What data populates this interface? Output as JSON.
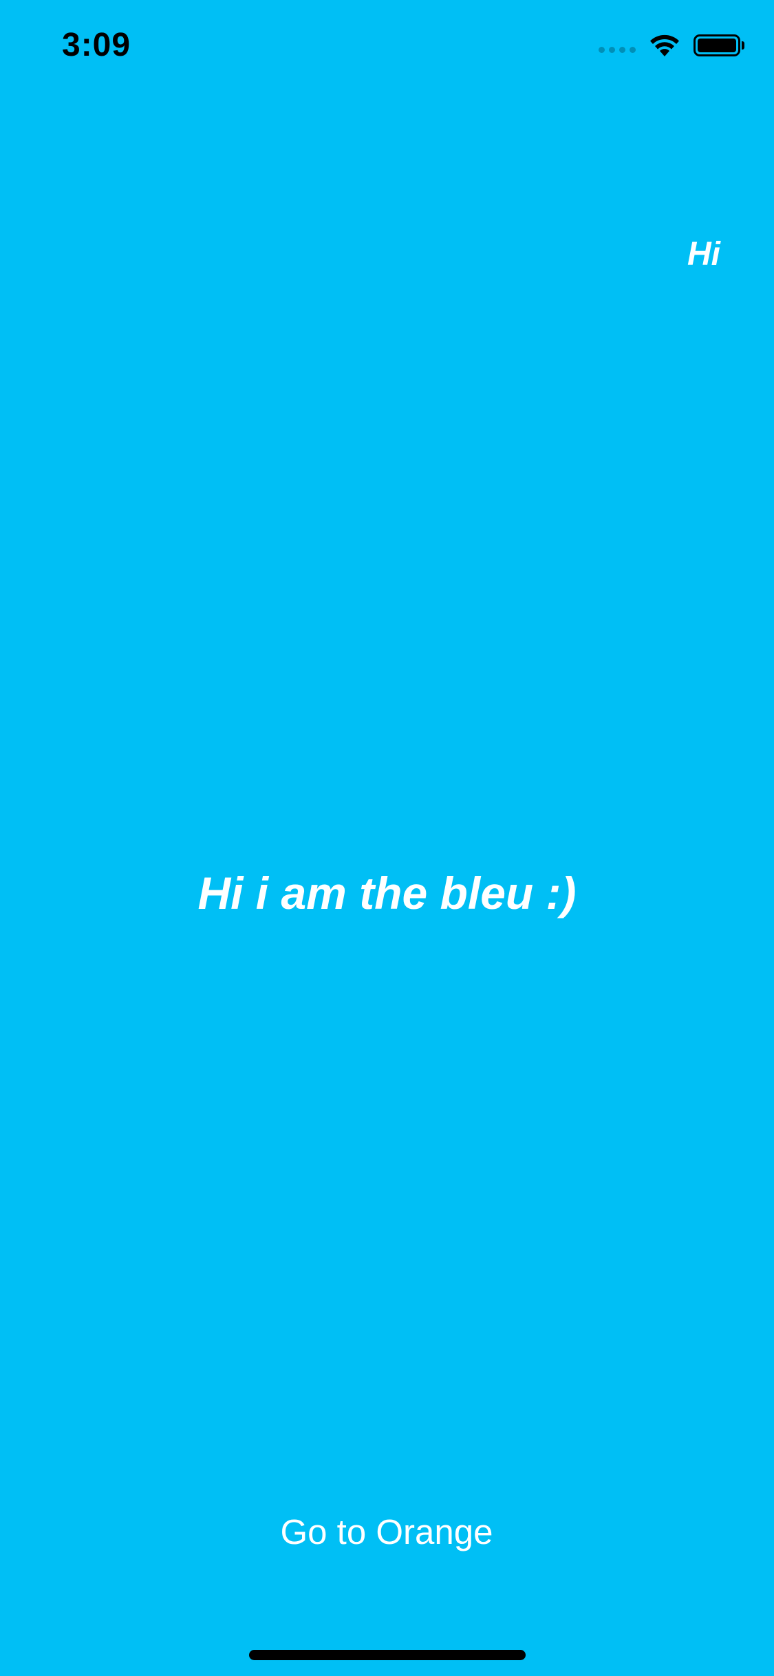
{
  "status_bar": {
    "time": "3:09",
    "icons": [
      "signal-dots-icon",
      "wifi-icon",
      "battery-icon"
    ],
    "battery_level": 1.0
  },
  "screen": {
    "background_color": "#00BFF5",
    "corner_label": "Hi",
    "main_label": "Hi i am the bleu :)",
    "button_label": "Go to Orange",
    "text_color": "#FFFFFF"
  }
}
